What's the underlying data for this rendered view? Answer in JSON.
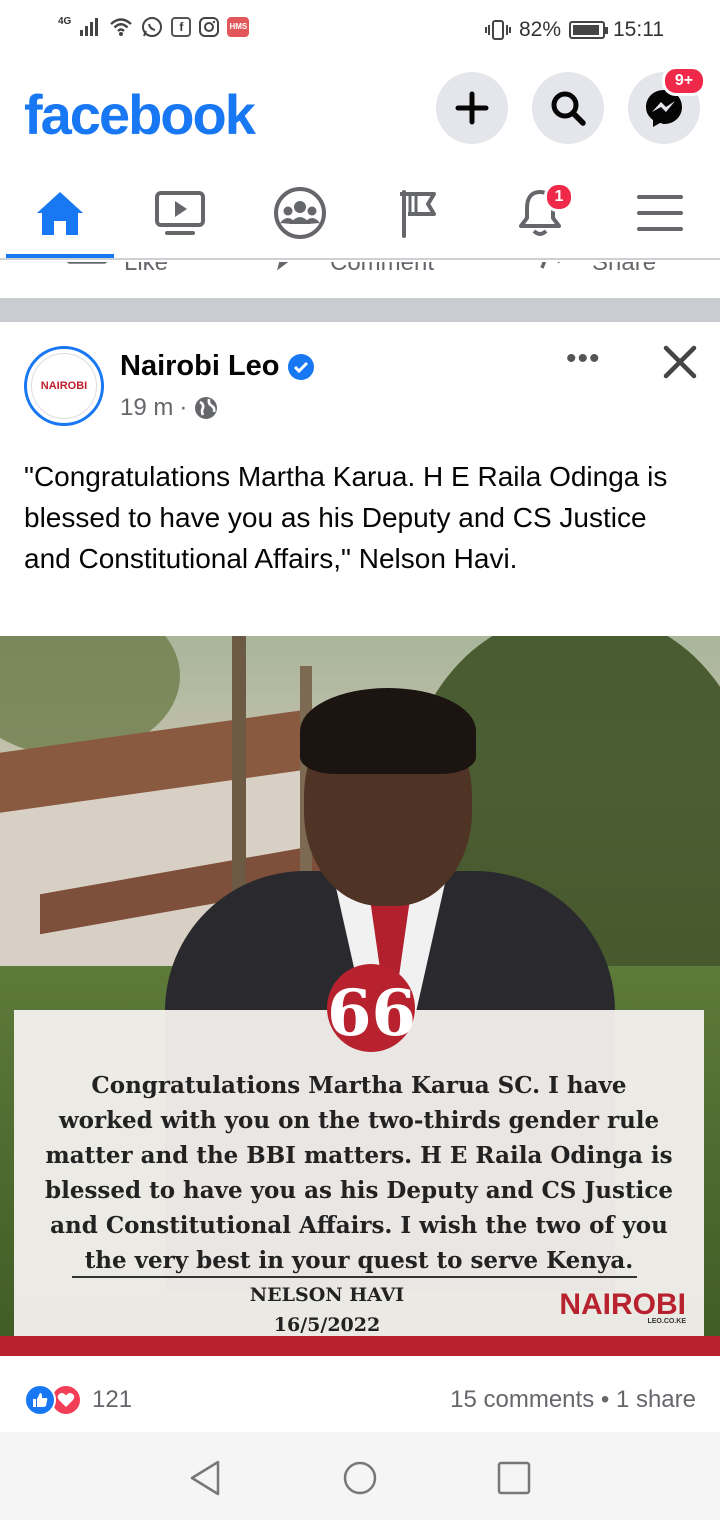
{
  "status_bar": {
    "network": "4G",
    "battery": "82%",
    "time": "15:11"
  },
  "header": {
    "logo": "facebook",
    "messenger_badge": "9+"
  },
  "tabs": {
    "notifications_badge": "1"
  },
  "cutoff_actions": {
    "like": "Like",
    "comment": "Comment",
    "share": "Share"
  },
  "post": {
    "page_name": "Nairobi Leo",
    "avatar_text": "NAIROBI",
    "time": "19 m",
    "separator": "·",
    "more": "•••",
    "text": "\"Congratulations Martha Karua. H E Raila Odinga is blessed to have you as his Deputy and CS Justice and Constitutional Affairs,\" Nelson Havi.",
    "image": {
      "quote_mark": "66",
      "quote_text": "Congratulations Martha Karua SC. I have worked with you on the two-thirds gender rule matter and the BBI matters. H E Raila Odinga is blessed to have you as his Deputy and CS Justice and Constitutional Affairs. I wish the two of you the very best in your quest to serve Kenya.",
      "author": "NELSON HAVI",
      "date": "16/5/2022",
      "logo": "NAIROBI",
      "logo_sub": "LEO.CO.KE"
    },
    "reaction_count": "121",
    "comments_shares": "15 comments • 1 share"
  },
  "colors": {
    "facebook_blue": "#1877f2",
    "badge_red": "#f02849",
    "brand_red": "#b8222e",
    "secondary_text": "#65676b"
  }
}
